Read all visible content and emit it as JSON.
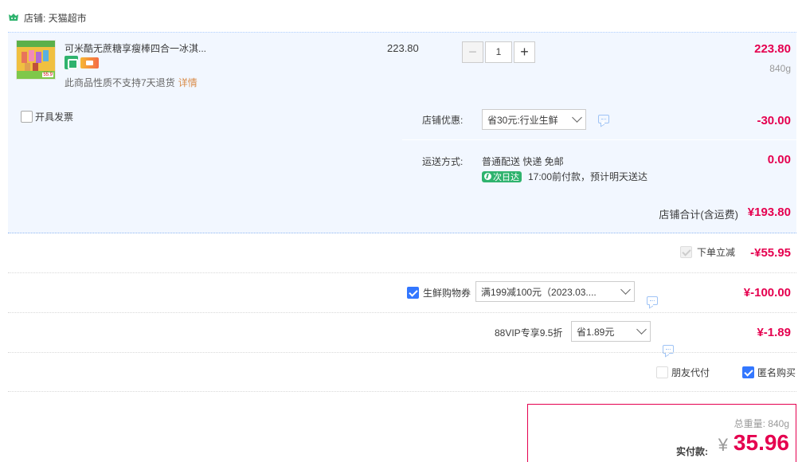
{
  "shop": {
    "label": "店铺: 天猫超市"
  },
  "item": {
    "title": "可米酷无蔗糖享瘦棒四合一冰淇...",
    "note": "此商品性质不支持7天退货",
    "note_link": "详情",
    "unit_price": "223.80",
    "quantity": "1",
    "line_total": "223.80",
    "weight": "840g",
    "thumb_tag": "55.9"
  },
  "options": {
    "invoice_label": "开具发票",
    "shop_discount_label": "店铺优惠:",
    "shop_discount_select": "省30元:行业生鲜",
    "shop_discount_amount": "-30.00",
    "shipping_label": "运送方式:",
    "shipping_method": "普通配送 快递 免邮",
    "next_day_badge": "次日达",
    "shipping_note": "17:00前付款，预计明天送达",
    "shipping_amount": "0.00"
  },
  "subtotal": {
    "label": "店铺合计(含运费)",
    "amount": "¥193.80"
  },
  "instant_discount": {
    "label": "下单立减",
    "amount": "-¥55.95"
  },
  "fresh_coupon": {
    "label": "生鲜购物券",
    "select": "满199减100元（2023.03....",
    "amount": "¥-100.00"
  },
  "vip": {
    "label": "88VIP专享9.5折",
    "select": "省1.89元",
    "amount": "¥-1.89"
  },
  "checks": {
    "friend_pay": "朋友代付",
    "anonymous": "匿名购买"
  },
  "totals": {
    "weight_label": "总重量:",
    "weight_value": "840g",
    "pay_label": "实付款:",
    "yen": "¥",
    "pay_amount": "35.96"
  },
  "colors": {
    "accent_red": "#e5004f",
    "accent_blue": "#3377ff",
    "row_bg": "#f2f7ff"
  }
}
